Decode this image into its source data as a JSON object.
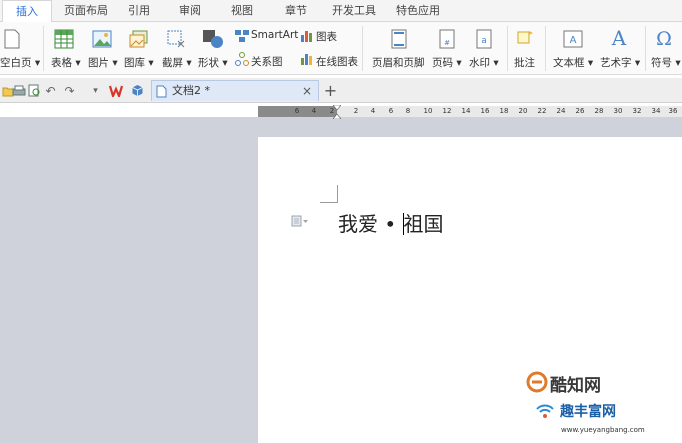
{
  "tabs": [
    "插入",
    "页面布局",
    "引用",
    "审阅",
    "视图",
    "章节",
    "开发工具",
    "特色应用"
  ],
  "active_tab": "插入",
  "ribbon": {
    "blank_page": "空白页",
    "table": "表格",
    "picture": "图片",
    "gallery": "图库",
    "screenshot": "截屏",
    "shape": "形状",
    "smartart": "SmartArt",
    "chart": "图表",
    "relation_chart": "关系图",
    "online_chart": "在线图表",
    "header_footer": "页眉和页脚",
    "page_number": "页码",
    "watermark": "水印",
    "comment": "批注",
    "textbox": "文本框",
    "wordart": "艺术字",
    "symbol": "符号"
  },
  "document": {
    "tab_title": "文档2 *",
    "text_before_cursor": "我爱 • ",
    "text_after_cursor": "祖国"
  },
  "ruler": {
    "left_labels": [
      "6",
      "4",
      "2"
    ],
    "right_labels": [
      "2",
      "4",
      "6",
      "8",
      "10",
      "12",
      "14",
      "16",
      "18",
      "20",
      "22",
      "24",
      "26",
      "28",
      "30",
      "32",
      "34",
      "36"
    ]
  },
  "colors": {
    "accent": "#2a6fd6",
    "workspace": "#cfd2db",
    "wps_red": "#d9342b"
  },
  "watermark_text": {
    "site_name_1": "酷知网",
    "site_name_2": "趣丰富网",
    "url": "www.yueyangbang.com"
  }
}
